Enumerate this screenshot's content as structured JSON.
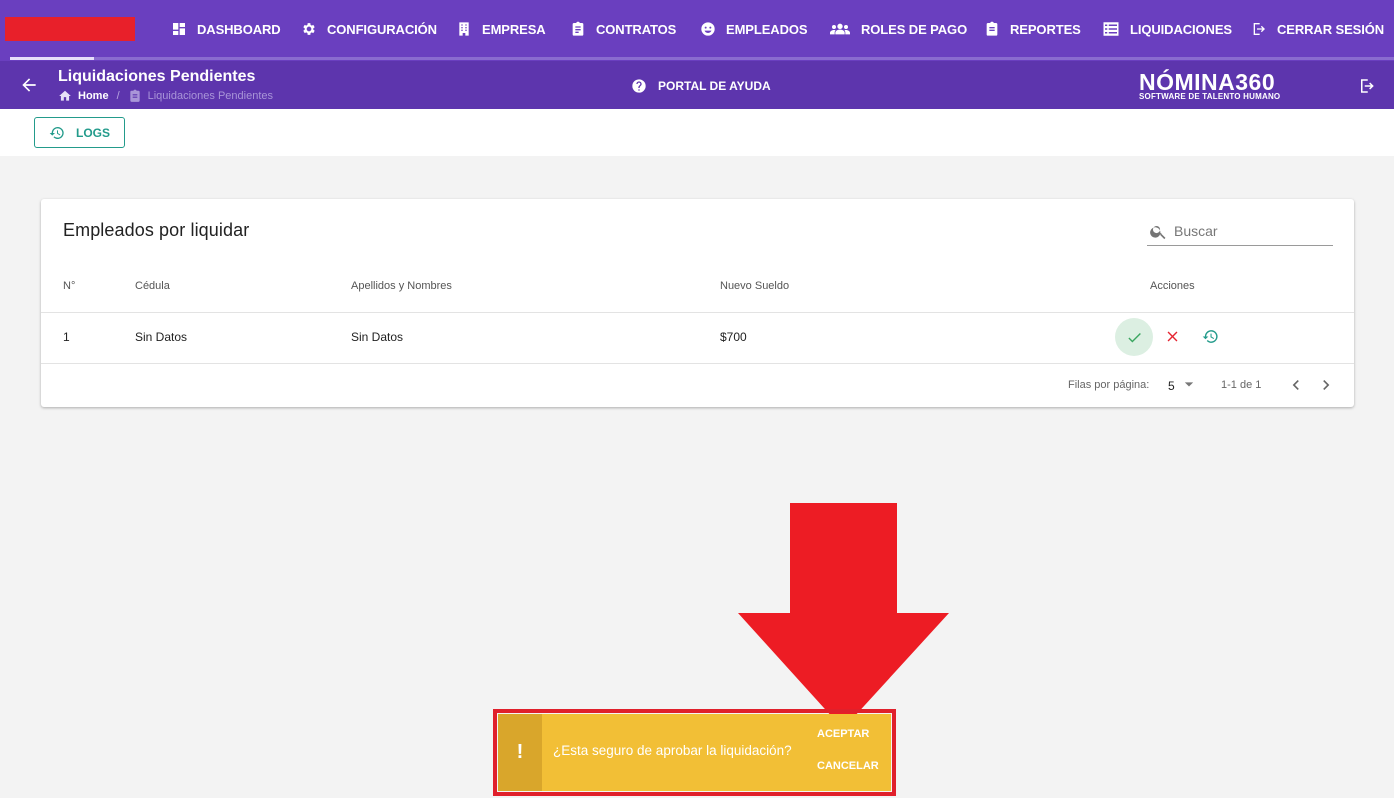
{
  "nav": {
    "items": [
      {
        "label": "DASHBOARD",
        "icon": "dashboard-icon"
      },
      {
        "label": "CONFIGURACIÓN",
        "icon": "gear-icon"
      },
      {
        "label": "EMPRESA",
        "icon": "building-icon"
      },
      {
        "label": "CONTRATOS",
        "icon": "clipboard-icon"
      },
      {
        "label": "EMPLEADOS",
        "icon": "user-circle-icon"
      },
      {
        "label": "ROLES DE PAGO",
        "icon": "users-icon"
      },
      {
        "label": "REPORTES",
        "icon": "report-icon"
      },
      {
        "label": "LIQUIDACIONES",
        "icon": "list-icon"
      },
      {
        "label": "CERRAR SESIÓN",
        "icon": "logout-icon"
      }
    ]
  },
  "header": {
    "title": "Liquidaciones Pendientes",
    "breadcrumb": {
      "home": "Home",
      "current": "Liquidaciones Pendientes"
    },
    "help_label": "PORTAL DE AYUDA",
    "brand": {
      "name": "NÓMINA360",
      "tagline": "SOFTWARE DE TALENTO HUMANO"
    }
  },
  "toolbar": {
    "logs_label": "LOGS"
  },
  "table": {
    "title": "Empleados por liquidar",
    "search_placeholder": "Buscar",
    "columns": [
      "N°",
      "Cédula",
      "Apellidos y Nombres",
      "Nuevo Sueldo",
      "Acciones"
    ],
    "rows": [
      {
        "n": "1",
        "cedula": "Sin Datos",
        "nombres": "Sin Datos",
        "sueldo": "$700"
      }
    ],
    "footer": {
      "rows_label": "Filas por página:",
      "rows_per_page": "5",
      "range": "1-1 de 1"
    }
  },
  "snackbar": {
    "icon": "!",
    "message": "¿Esta seguro de aprobar la liquidación?",
    "accept_label": "ACEPTAR",
    "cancel_label": "CANCELAR",
    "colors": {
      "background": "#f2bf36",
      "icon_background": "#d9a62b"
    }
  },
  "colors": {
    "nav": "#6a3fbf",
    "subheader": "#5d35ad",
    "accent": "#239b8b",
    "annotation": "#e0202b"
  }
}
